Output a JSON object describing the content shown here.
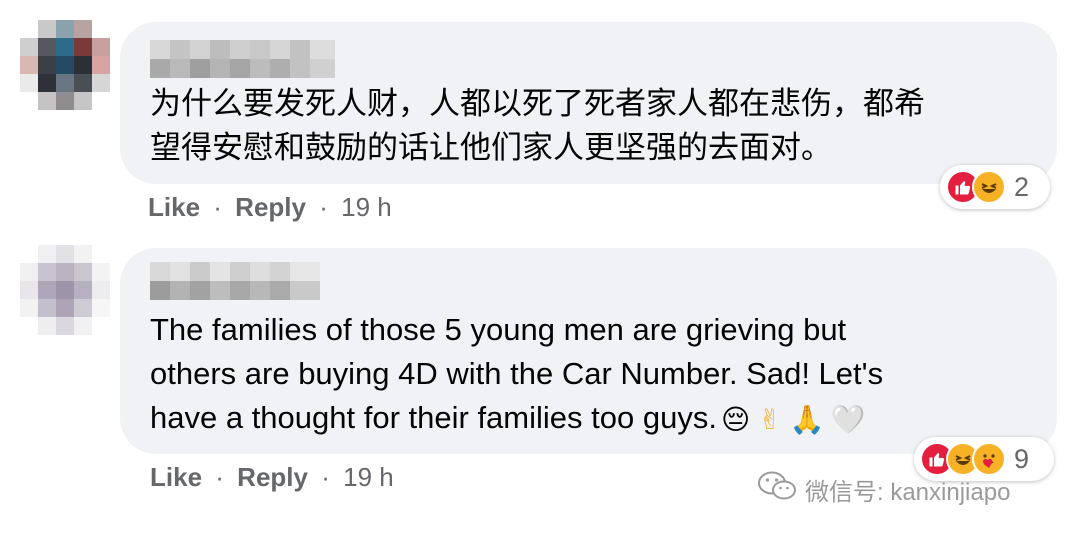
{
  "comments": [
    {
      "text_lines": [
        "为什么要发死人财，人都以死了死者家人都在悲伤，都希",
        "望得安慰和鼓励的话让他们家人更坚强的去面对。"
      ],
      "like_label": "Like",
      "reply_label": "Reply",
      "separator": "·",
      "time": "19 h",
      "reaction_count": "2",
      "reactions": [
        "like-icon",
        "haha-icon"
      ]
    },
    {
      "text_lines": [
        "The families of those 5 young men are grieving but",
        "others are buying 4D with the Car Number. Sad! Let's",
        "have a thought for their families too guys."
      ],
      "emojis": [
        "😔",
        "✌",
        "🙏",
        "🤍"
      ],
      "like_label": "Like",
      "reply_label": "Reply",
      "separator": "·",
      "time": "19 h",
      "reaction_count": "9",
      "reactions": [
        "like-icon",
        "haha-icon",
        "care-icon"
      ]
    }
  ],
  "watermark": {
    "text": "微信号: kanxinjiapo",
    "icon": "wechat-icon"
  },
  "colors": {
    "bubble": "#f0f2f5",
    "text": "#050505",
    "meta": "#65676b",
    "like_red": "#e41e3f",
    "haha_yellow": "#f7b125"
  }
}
